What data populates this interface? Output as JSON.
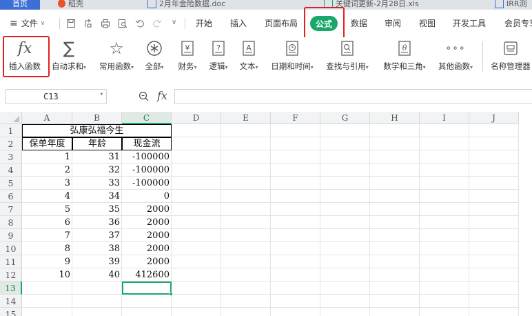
{
  "doc_tabs": [
    {
      "label": "首页",
      "kind": "home"
    },
    {
      "label": "稻壳",
      "kind": "docer"
    },
    {
      "label": "2月年金险数据.doc",
      "kind": "doc"
    },
    {
      "label": "关键词更新-2月28日.xls",
      "kind": "xls"
    },
    {
      "label": "IRR测",
      "kind": "doc"
    }
  ],
  "menu": {
    "file_label": "文件",
    "tabs": [
      "开始",
      "插入",
      "页面布局",
      "公式",
      "数据",
      "审阅",
      "视图",
      "开发工具",
      "会员专享"
    ],
    "active_tab": "公式"
  },
  "ribbon": {
    "buttons": [
      {
        "name": "insert-function",
        "label": "插入函数",
        "icon": "fx",
        "dropdown": false
      },
      {
        "name": "autosum",
        "label": "自动求和",
        "icon": "sigma",
        "dropdown": true
      },
      {
        "name": "common-functions",
        "label": "常用函数",
        "icon": "star",
        "dropdown": true
      },
      {
        "name": "all-functions",
        "label": "全部",
        "icon": "asterisk",
        "dropdown": true
      },
      {
        "name": "financial",
        "label": "财务",
        "icon": "yen",
        "dropdown": true
      },
      {
        "name": "logical",
        "label": "逻辑",
        "icon": "question",
        "dropdown": true
      },
      {
        "name": "text",
        "label": "文本",
        "icon": "A",
        "dropdown": true
      },
      {
        "name": "datetime",
        "label": "日期和时间",
        "icon": "clock",
        "dropdown": true
      },
      {
        "name": "lookup",
        "label": "查找与引用",
        "icon": "magnifier",
        "dropdown": true
      },
      {
        "name": "math",
        "label": "数学和三角",
        "icon": "theta",
        "dropdown": true
      },
      {
        "name": "other",
        "label": "其他函数",
        "icon": "dots",
        "dropdown": true
      },
      {
        "name": "name-manager",
        "label": "名称管理器",
        "icon": "tag",
        "dropdown": false
      }
    ]
  },
  "formula_bar": {
    "name_box": "C13",
    "formula": ""
  },
  "sheet": {
    "columns": [
      "A",
      "B",
      "C",
      "D",
      "E",
      "F",
      "G",
      "H",
      "I",
      "J"
    ],
    "selected_column": "C",
    "rows": [
      "1",
      "2",
      "3",
      "4",
      "5",
      "6",
      "7",
      "8",
      "9",
      "10",
      "11",
      "12",
      "13",
      "14",
      "15"
    ],
    "selected_row": "13",
    "title": "弘康弘福今生",
    "headers": [
      "保单年度",
      "年龄",
      "现金流"
    ],
    "data": [
      [
        "1",
        "31",
        "-100000"
      ],
      [
        "2",
        "32",
        "-100000"
      ],
      [
        "3",
        "33",
        "-100000"
      ],
      [
        "4",
        "34",
        "0"
      ],
      [
        "5",
        "35",
        "2000"
      ],
      [
        "6",
        "36",
        "2000"
      ],
      [
        "7",
        "37",
        "2000"
      ],
      [
        "8",
        "38",
        "2000"
      ],
      [
        "9",
        "39",
        "2000"
      ],
      [
        "10",
        "40",
        "412600"
      ]
    ]
  },
  "colors": {
    "accent": "#1aa86a",
    "highlight": "#e02020"
  }
}
